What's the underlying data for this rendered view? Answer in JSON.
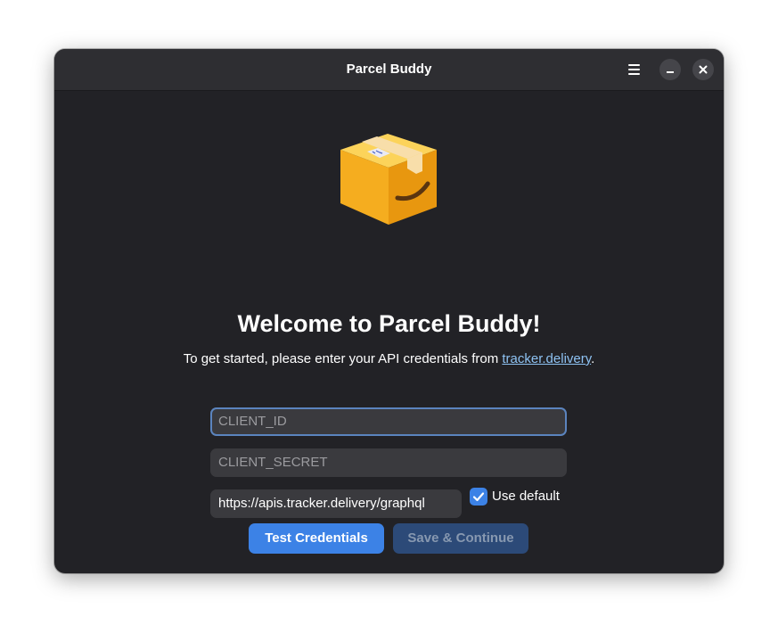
{
  "window": {
    "title": "Parcel Buddy"
  },
  "icons": {
    "menu": "hamburger-menu-icon",
    "minimize": "minimize-icon",
    "close": "close-icon",
    "logo": "parcel-box-logo",
    "checkmark": "checkmark-icon"
  },
  "welcome": {
    "heading": "Welcome to Parcel Buddy!",
    "subtitle_prefix": "To get started, please enter your API credentials from ",
    "subtitle_link": "tracker.delivery",
    "subtitle_suffix": "."
  },
  "form": {
    "client_id": {
      "placeholder": "CLIENT_ID",
      "value": ""
    },
    "client_secret": {
      "placeholder": "CLIENT_SECRET",
      "value": ""
    },
    "endpoint": {
      "value": "https://apis.tracker.delivery/graphql"
    },
    "use_default": {
      "label": "Use default",
      "checked": true
    }
  },
  "buttons": {
    "test": "Test Credentials",
    "save": "Save & Continue"
  },
  "colors": {
    "accent": "#3c82e6",
    "link": "#8ec2f2",
    "window_bg": "#222226",
    "titlebar_bg": "#2e2e32"
  }
}
